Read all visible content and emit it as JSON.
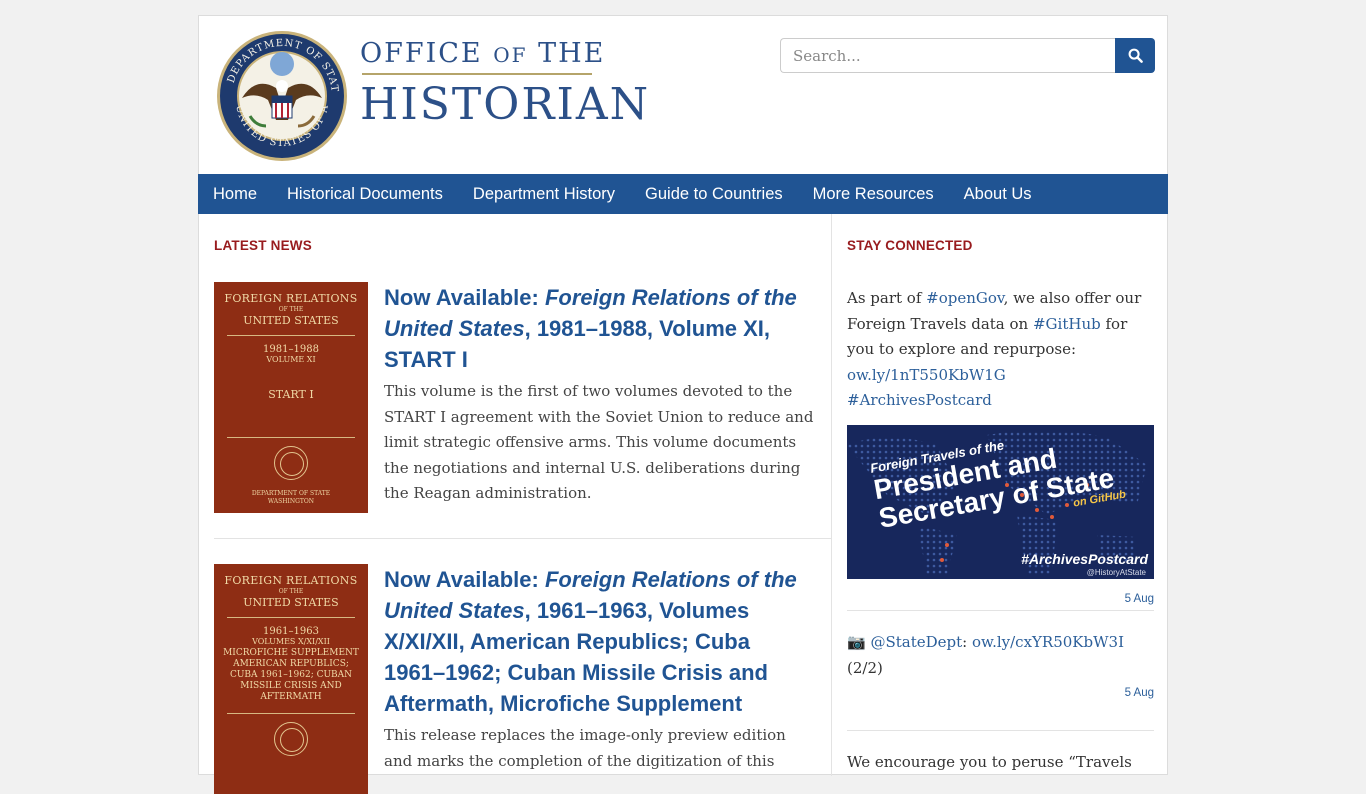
{
  "header": {
    "logo_line1_a": "OFFICE ",
    "logo_line1_of": "OF",
    "logo_line1_b": " THE",
    "logo_line2": "HISTORIAN",
    "seal_alt": "Department of State seal"
  },
  "search": {
    "placeholder": "Search..."
  },
  "nav": {
    "items": [
      "Home",
      "Historical Documents",
      "Department History",
      "Guide to Countries",
      "More Resources",
      "About Us"
    ]
  },
  "latest_news": {
    "title": "LATEST NEWS",
    "items": [
      {
        "title_prefix": "Now Available: ",
        "title_italic": "Foreign Relations of the United States",
        "title_suffix": ", 1981–1988, Volume XI, START I",
        "description": "This volume is the first of two volumes devoted to the START I agreement with the Soviet Union to reduce and limit strategic offensive arms. This volume documents the negotiations and internal U.S. deliberations during the Reagan administration.",
        "cover": {
          "line1": "FOREIGN RELATIONS",
          "line2": "OF THE",
          "line3": "UNITED STATES",
          "years": "1981–1988",
          "volume": "VOLUME XI",
          "subject": "START I",
          "dept": "DEPARTMENT OF STATE",
          "city": "WASHINGTON"
        }
      },
      {
        "title_prefix": "Now Available: ",
        "title_italic": "Foreign Relations of the United States",
        "title_suffix": ", 1961–1963, Volumes X/XI/XII, American Republics; Cuba 1961–1962; Cuban Missile Crisis and Aftermath, Microfiche Supplement",
        "description": "This release replaces the image-only preview edition and marks the completion of the digitization of this",
        "cover": {
          "line1": "FOREIGN RELATIONS",
          "line2": "OF THE",
          "line3": "UNITED STATES",
          "years": "1961–1963",
          "volume": "VOLUMES X/XI/XII",
          "subject": "MICROFICHE SUPPLEMENT AMERICAN REPUBLICS; CUBA 1961–1962; CUBAN MISSILE CRISIS AND AFTERMATH"
        }
      }
    ]
  },
  "stay_connected": {
    "title": "STAY CONNECTED",
    "tweets": [
      {
        "t1": "As part of ",
        "l1": "#openGov",
        "t2": ", we also offer our Foreign Travels data on ",
        "l2": "#GitHub",
        "t3": " for you to explore and repurpose: ",
        "l3": "ow.ly/1nT550KbW1G",
        "t4": " ",
        "l4": "#ArchivesPostcard",
        "image": {
          "small": "Foreign Travels of the",
          "big1": "President and",
          "big2": "Secretary of State",
          "github": "on GitHub",
          "tag": "#ArchivesPostcard",
          "handle": "@HistoryAtState"
        },
        "date": "5 Aug"
      },
      {
        "icon": "📷",
        "l1": "@StateDept",
        "t1": ": ",
        "l2": "ow.ly/cxYR50KbW3I",
        "t2": " (2/2)",
        "date": "5 Aug"
      },
      {
        "t1": "We encourage you to peruse “Travels"
      }
    ]
  },
  "colors": {
    "nav_bg": "#205493",
    "section_title": "#981b1e",
    "link": "#205493",
    "cover_bg": "#8e2d14"
  }
}
